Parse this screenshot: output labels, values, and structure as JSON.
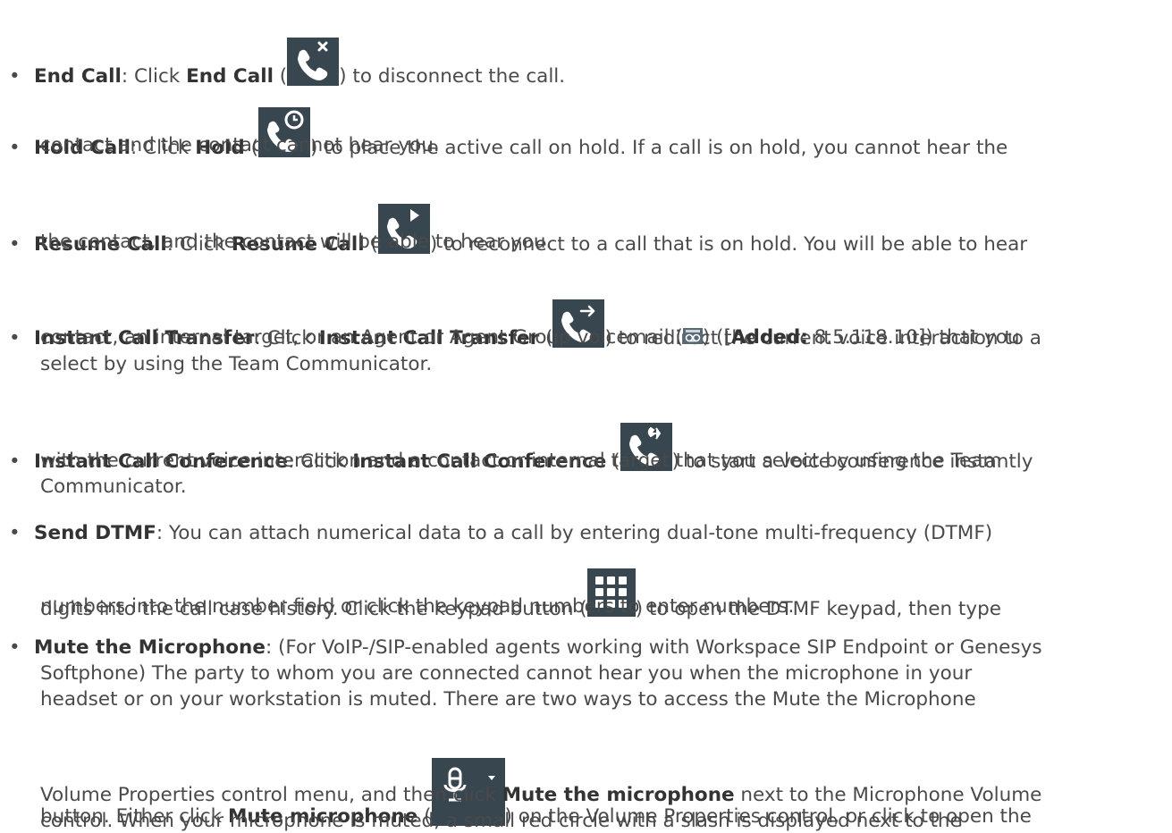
{
  "doc": {
    "end_call": {
      "bullet": "•",
      "term": "End Call",
      "colon_click": ": Click ",
      "button": "End Call",
      "open": " (",
      "after": ") to disconnect the call.",
      "icon": "end-call-icon"
    },
    "hold_call": {
      "bullet": "•",
      "term": "Hold Call",
      "colon_click": ": Click ",
      "button": "Hold",
      "open": " (",
      "after": ") to place the active call on hold. If a call is on hold, you cannot hear the",
      "line2": "contact and the contact cannot hear you.",
      "icon": "hold-call-icon"
    },
    "resume_call": {
      "bullet": "•",
      "term": "Resume Call",
      "colon_click": ": Click ",
      "button": "Resume Call",
      "open": " (",
      "after": ") to reconnect to a call that is on hold. You will be able to hear",
      "line2": "the contact, and the contact will be able to hear you.",
      "icon": "resume-call-icon"
    },
    "transfer": {
      "bullet": "•",
      "term": "Instant Call Transfer",
      "colon_click": ": Click ",
      "button": "Instant Call Transfer",
      "open": " (",
      "after": ") to redirect the current voice interaction to a",
      "line2_a": "contact, an internal target, or an Agent or Agent Group voicemail (",
      "line2_b": ") ([",
      "added_label": "Added:",
      "added_version": " 8.5.118.10",
      "line2_c": "]) that you",
      "line3": "select by using the Team Communicator.",
      "icon": "transfer-call-icon",
      "voicemail_icon": "voicemail-icon"
    },
    "conference": {
      "bullet": "•",
      "term": "Instant Call Conference",
      "colon_click": ": Click ",
      "button": "Instant Call Conference",
      "open": " (",
      "after": ") to start a voice conference instantly",
      "line2": "with the current voice interaction and a contact or internal target that you select by using the Team",
      "line3": "Communicator.",
      "icon": "conference-call-icon"
    },
    "dtmf": {
      "bullet": "•",
      "term": "Send DTMF",
      "line1": ": You can attach numerical data to a call by entering dual-tone multi-frequency (DTMF)",
      "line2_a": "digits into the call case history. Click the keypad button (",
      "line2_b": ") to open the DTMF keypad, then type",
      "line3": "numbers into the number field or click the keypad numbers to enter numbers.",
      "icon": "keypad-icon"
    },
    "mute": {
      "bullet": "•",
      "term": "Mute the Microphone",
      "line1": ": (For VoIP-/SIP-enabled agents working with Workspace SIP Endpoint or Genesys",
      "line2": "Softphone) The party to whom you are connected cannot hear you when the microphone in your",
      "line3": "headset or on your workstation is muted. There are two ways to access the Mute the Microphone",
      "line4_a": "button. Either click ",
      "line4_bold": "Mute microphone",
      "line4_b": " (",
      "line4_c": ") on the Volume Properties control, or click to open the",
      "line5_a": "Volume Properties control menu, and then click ",
      "line5_bold": "Mute the microphone",
      "line5_b": " next to the Microphone Volume",
      "line6": "control. When your microphone is muted, a small red circle with a slash is displayed next to the",
      "icon": "microphone-icon",
      "dropdown_icon": "chevron-down-icon"
    }
  },
  "colors": {
    "text": "#4a4a4a",
    "bold": "#333333",
    "icon_bg": "#384650",
    "icon_fg": "#ffffff"
  }
}
